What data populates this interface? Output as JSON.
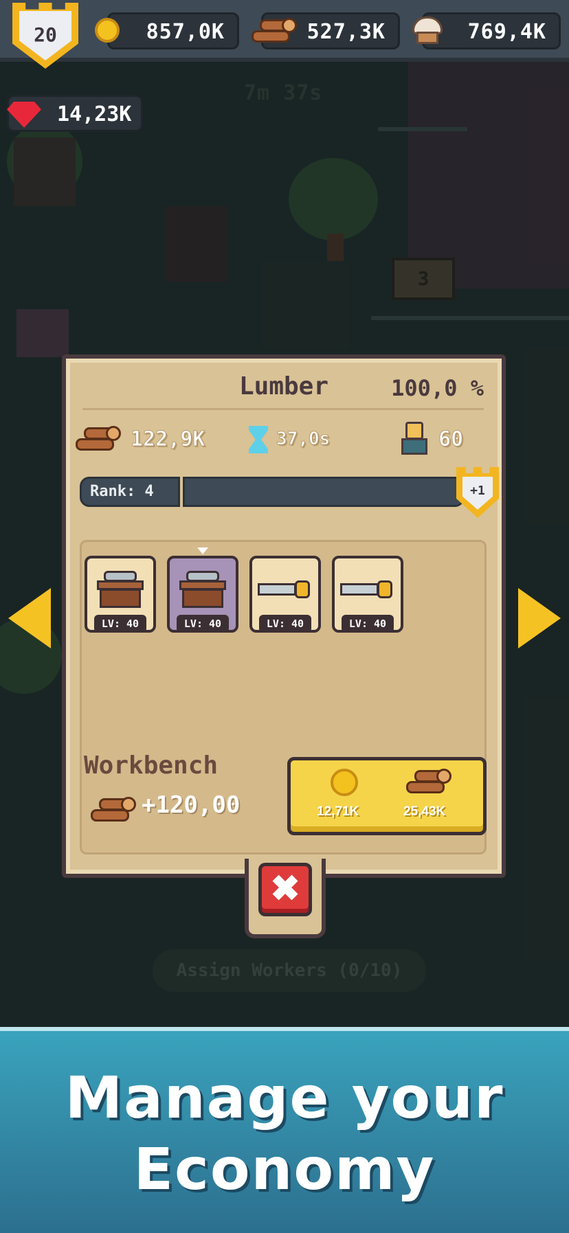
{
  "hud": {
    "level": "20",
    "gold": "857,0K",
    "wood": "527,3K",
    "food": "769,4K",
    "gems": "14,23K"
  },
  "scene": {
    "timer": "7m 37s",
    "sign_number": "3",
    "assign_workers_label": "Assign Workers (0/10)"
  },
  "panel": {
    "title": "Lumber",
    "efficiency": "100,0 %",
    "stats": {
      "wood_rate": "122,9K",
      "time": "37,0s",
      "workers": "60"
    },
    "rank": {
      "label": "Rank: 4",
      "progress_fraction": 1.0,
      "badge": "+1"
    },
    "items": [
      {
        "type": "workbench",
        "level": "LV: 40",
        "selected": false
      },
      {
        "type": "workbench",
        "level": "LV: 40",
        "selected": true
      },
      {
        "type": "saw",
        "level": "LV: 40",
        "selected": false
      },
      {
        "type": "saw",
        "level": "LV: 40",
        "selected": false
      }
    ],
    "selected_item": {
      "name": "Workbench",
      "yield": "+120,00"
    },
    "upgrade": {
      "gold_cost": "12,71K",
      "wood_cost": "25,43K"
    }
  },
  "banner": {
    "line1": "Manage your",
    "line2": "Economy"
  },
  "colors": {
    "accent_gold": "#f5c224",
    "close_red": "#e03b3b",
    "banner_blue": "#3aa3bd"
  }
}
